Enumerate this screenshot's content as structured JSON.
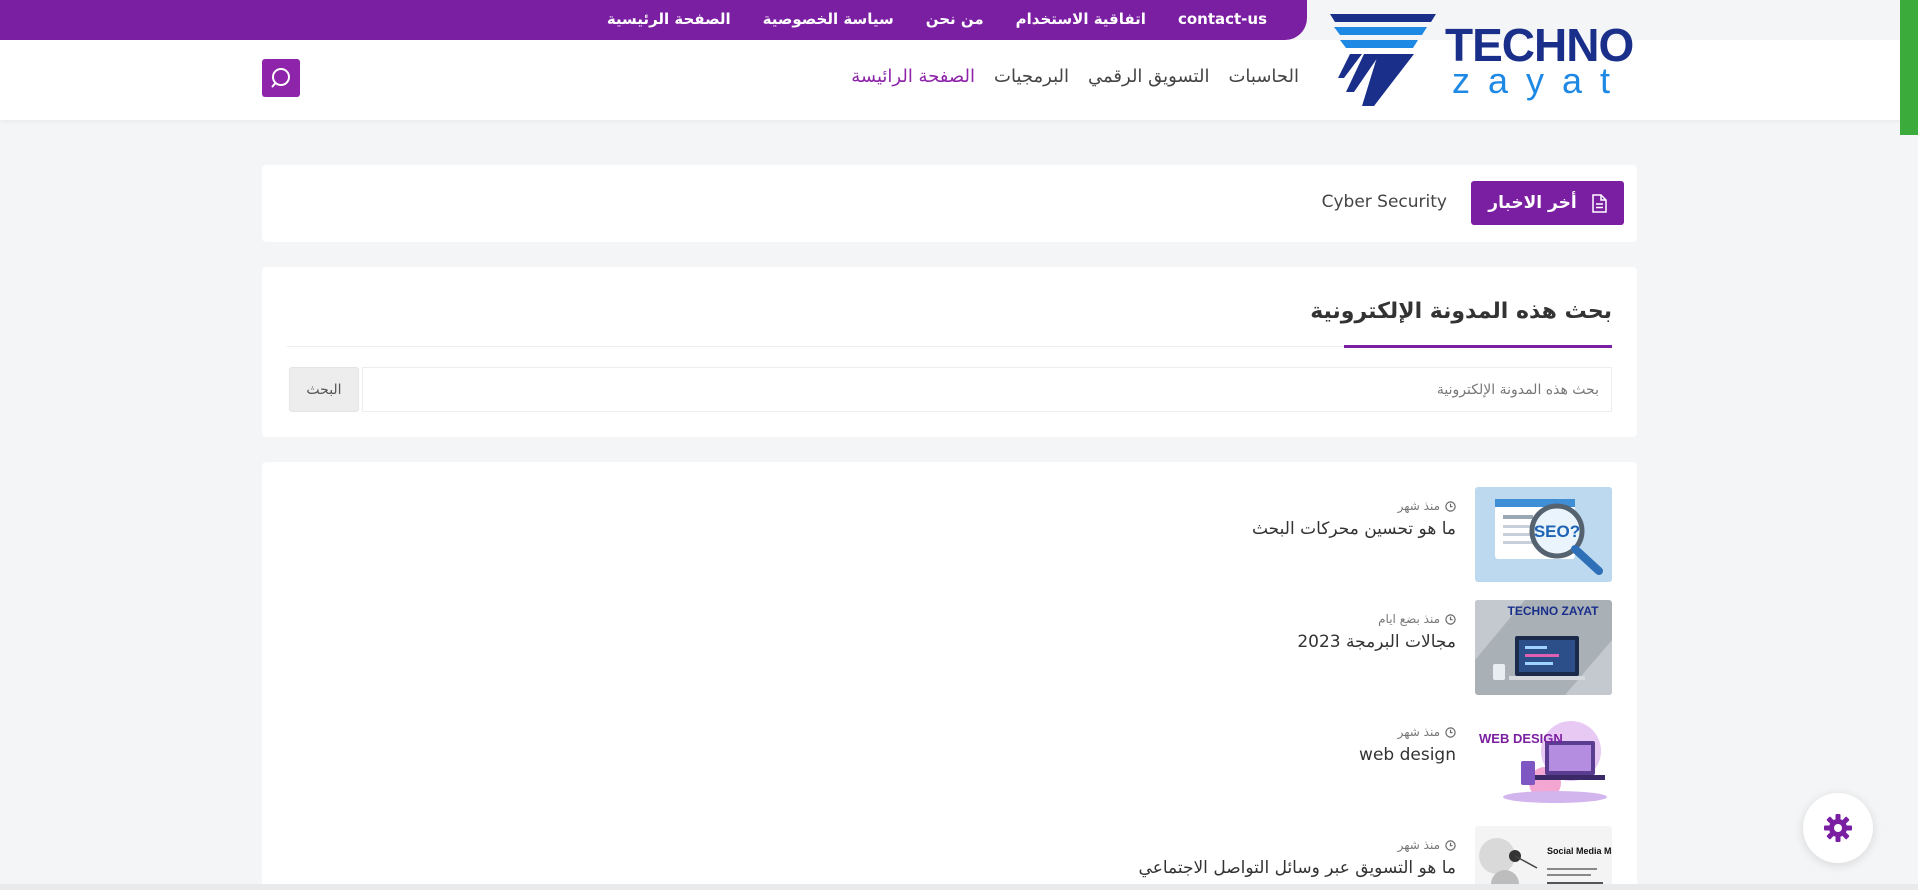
{
  "top_links": [
    "الصفحة الرئيسية",
    "سياسة الخصوصية",
    "من نحن",
    "اتفاقية الاستخدام",
    "contact-us"
  ],
  "logo": {
    "line1": "TECHNO",
    "line2": "zayat"
  },
  "main_nav": [
    "الصفحة الرائيسة",
    "البرمجيات",
    "التسويق الرقمي",
    "الحاسبات"
  ],
  "latest_news": {
    "label": "أخر الاخبار",
    "ticker": "Cyber Security"
  },
  "search_widget": {
    "title": "بحث هذه المدونة الإلكترونية",
    "placeholder": "بحث هذه المدونة الإلكترونية",
    "button": "البحث"
  },
  "posts": [
    {
      "time": "منذ شهر",
      "title": "ما هو تحسين محركات البحث",
      "thumb_label": "SEO?"
    },
    {
      "time": "منذ بضع ايام",
      "title": "مجالات البرمجة 2023",
      "thumb_label": "TECHNO ZAYAT"
    },
    {
      "time": "منذ شهر",
      "title": "web design",
      "thumb_label": "WEB DESIGN"
    },
    {
      "time": "منذ شهر",
      "title": "ما هو التسويق عبر وسائل التواصل الاجتماعي",
      "thumb_label": "Social Media Marketing (SMM)"
    }
  ],
  "colors": {
    "brand_purple": "#7b1fa2",
    "accent_green": "#3bab3b",
    "logo_navy": "#1a2f8a",
    "logo_blue": "#1e88e5"
  },
  "icons": {
    "search": "search-icon",
    "document": "document-icon",
    "clock": "clock-icon",
    "settings": "gear-icon"
  }
}
